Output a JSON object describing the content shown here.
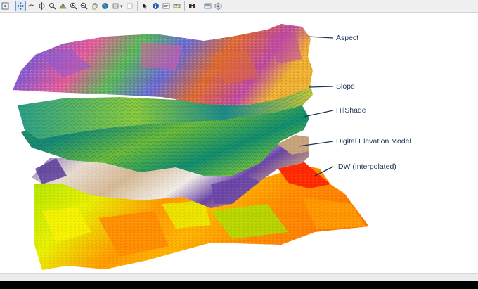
{
  "toolbar": {
    "tools": [
      {
        "name": "pan-tool-icon"
      },
      {
        "name": "full-extent-icon"
      },
      {
        "name": "identify-icon"
      },
      {
        "name": "zoom-in-icon"
      },
      {
        "name": "zoom-out-icon"
      },
      {
        "name": "hand-pan-icon"
      },
      {
        "name": "globe-icon"
      },
      {
        "name": "select-arrow-icon"
      },
      {
        "name": "info-icon"
      },
      {
        "name": "measure-icon"
      },
      {
        "name": "find-icon"
      },
      {
        "name": "layer-icon"
      },
      {
        "name": "nav-3d-icon"
      }
    ]
  },
  "scene": {
    "layers": [
      {
        "label": "Aspect"
      },
      {
        "label": "Slope"
      },
      {
        "label": "HilShade"
      },
      {
        "label": "Digital Elevation Model"
      },
      {
        "label": "IDW (Interpolated)"
      }
    ]
  },
  "colors": {
    "leader_line": "#1c3557",
    "label_text": "#1c3557",
    "idw": [
      "#a7e300",
      "#f7f200",
      "#ff8c00",
      "#ff2a00",
      "#e8f000"
    ],
    "dem": [
      "#6a3fa0",
      "#d4b896",
      "#f2efe8",
      "#8d7bbd"
    ],
    "hillshade": [
      "#1d8a6b",
      "#5fb93a",
      "#0f6f5e",
      "#8ccc3d"
    ],
    "slope": [
      "#1e8c8c",
      "#70c040",
      "#d8d040"
    ],
    "aspect": [
      "#e65a9a",
      "#8a5bd0",
      "#f0b030",
      "#5ab85a",
      "#e06a30"
    ]
  }
}
